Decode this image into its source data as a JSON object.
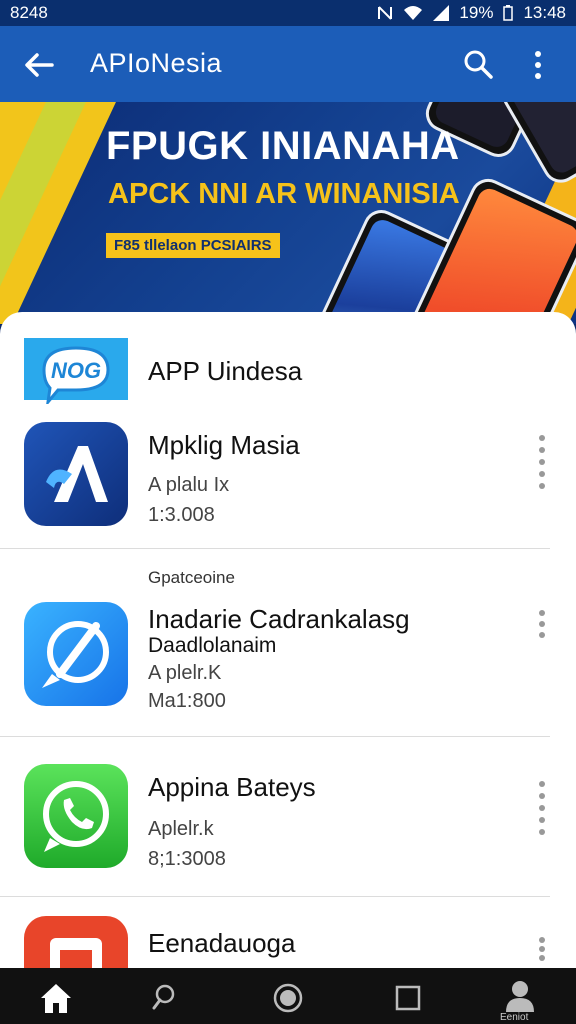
{
  "status_bar": {
    "left": "8248",
    "battery": "19%",
    "time": "13:48"
  },
  "app_bar": {
    "title": "APIoNesia"
  },
  "banner": {
    "headline": "FPUGK INIANAHA",
    "subheadline": "APCK NNI AR WINANISIA",
    "tag": "F85 tllelaon PCSIAIRS"
  },
  "section": {
    "title": "APP Uindesa",
    "logo_text": "NOG"
  },
  "apps": [
    {
      "name": "Mpklig Masia",
      "line1": "A plalu Ix",
      "line2": "1:3.008"
    },
    {
      "section_label": "Gpatceoine",
      "name": "Inadarie Cadrankalasg",
      "name2": "Daadlolanaim",
      "line1": "A plelr.K",
      "line2": "Ma1:800"
    },
    {
      "name": "Appina Bateys",
      "line1": "Aplelr.k",
      "line2": "8;1:3008"
    },
    {
      "name": "Eenadauoga"
    }
  ],
  "bottom_nav": {
    "caption": "Eeniot"
  },
  "colors": {
    "app_bar": "#1c5db8",
    "banner_accent": "#f6c21a",
    "nav_bg": "#111111"
  }
}
